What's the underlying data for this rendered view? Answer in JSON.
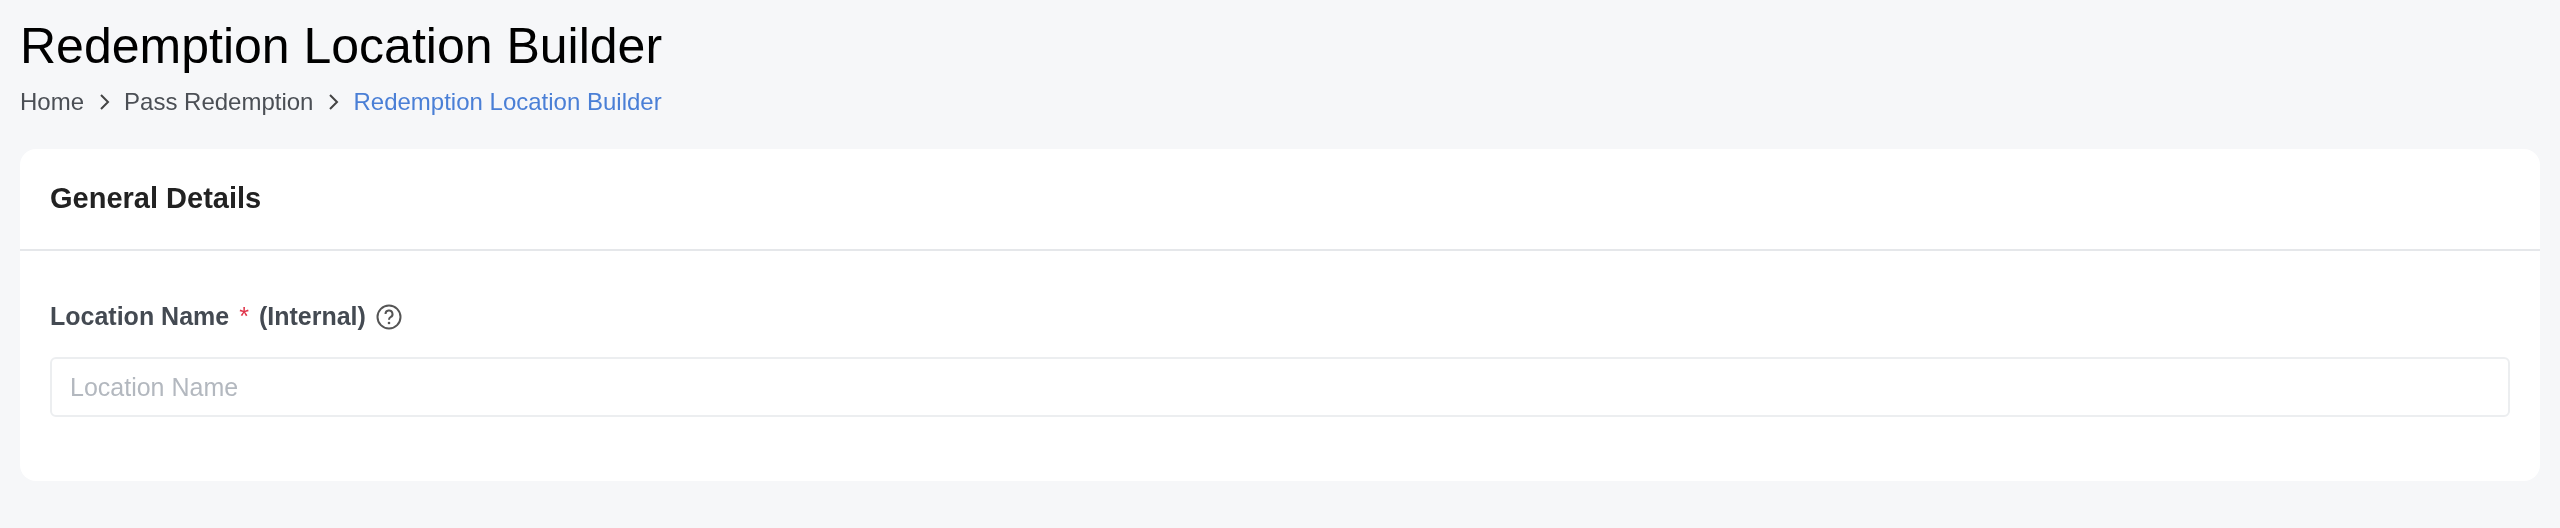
{
  "page_title": "Redemption Location Builder",
  "breadcrumb": [
    {
      "label": "Home",
      "current": false
    },
    {
      "label": "Pass Redemption",
      "current": false
    },
    {
      "label": "Redemption Location Builder",
      "current": true
    }
  ],
  "card": {
    "title": "General Details",
    "field": {
      "label": "Location Name",
      "required_mark": "*",
      "label_note": "(Internal)",
      "placeholder": "Location Name"
    }
  }
}
